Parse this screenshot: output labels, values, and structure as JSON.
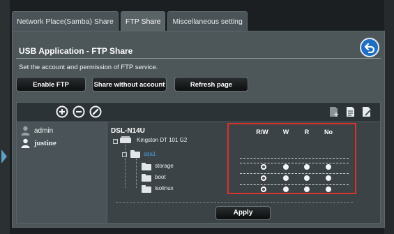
{
  "tabs": [
    {
      "label": "Network Place(Samba) Share"
    },
    {
      "label": "FTP Share"
    },
    {
      "label": "Miscellaneous setting"
    }
  ],
  "page": {
    "title": "USB Application - FTP Share",
    "description": "Set the account and permission of FTP service."
  },
  "actions": {
    "enable_ftp": "Enable FTP",
    "share_without_account": "Share without account",
    "refresh_page": "Refresh page",
    "apply": "Apply"
  },
  "users": [
    {
      "name": "admin",
      "selected": false
    },
    {
      "name": "justine",
      "selected": true
    }
  ],
  "device": {
    "name": "DSL-N14U",
    "disk": "Kingston DT 101 G2",
    "partition": "sda1",
    "folders": [
      "storage",
      "boot",
      "isolinux"
    ]
  },
  "permissions": {
    "headers": [
      "R/W",
      "W",
      "R",
      "No"
    ],
    "selected": [
      "R/W",
      "R/W",
      "R/W"
    ]
  },
  "colors": {
    "highlight_border": "#d8322e",
    "link_blue": "#4aa3e6",
    "back_button": "#1e6fc4"
  }
}
